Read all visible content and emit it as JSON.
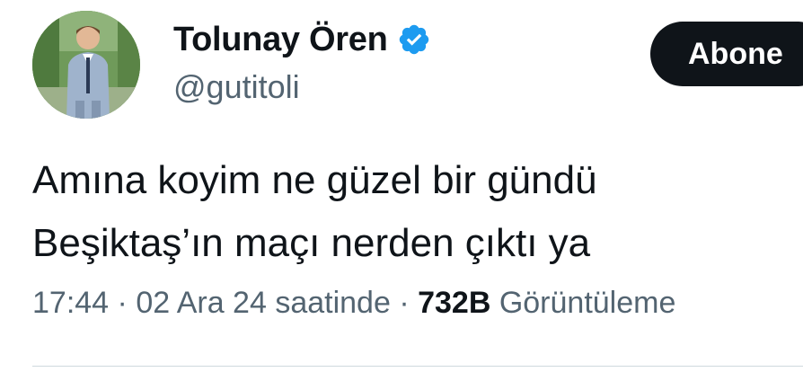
{
  "author": {
    "display_name": "Tolunay Ören",
    "handle": "@gutitoli",
    "verified": true
  },
  "subscribe_button": {
    "label": "Abone"
  },
  "tweet": {
    "lines": [
      "Amına koyim ne güzel bir gündü",
      "Beşiktaş’ın maçı nerden çıktı ya"
    ]
  },
  "meta": {
    "time": "17:44",
    "separator": " · ",
    "date": "02 Ara 24 saatinde",
    "separator2": " · ",
    "views_count": "732B",
    "views_label": "Görüntüleme"
  },
  "colors": {
    "verified_blue": "#1d9bf0",
    "text_primary": "#0f1419",
    "text_secondary": "#536471",
    "button_bg": "#0f1419"
  }
}
